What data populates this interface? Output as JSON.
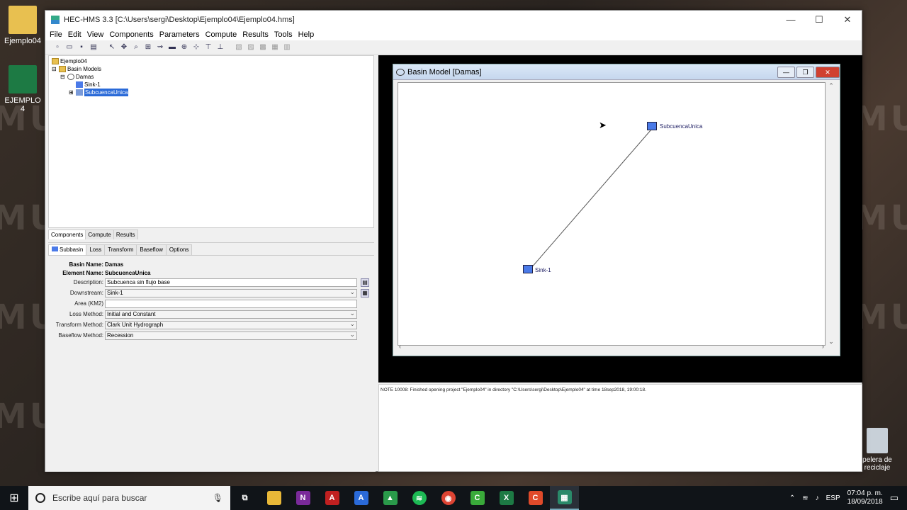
{
  "desktop": {
    "icons": [
      {
        "label": "Ejemplo04"
      },
      {
        "label": "EJEMPLO 4"
      },
      {
        "label": "pelera de reciclaje"
      }
    ],
    "wallpaper_text": "MUSE"
  },
  "window": {
    "title": "HEC-HMS 3.3 [C:\\Users\\sergi\\Desktop\\Ejemplo04\\Ejemplo04.hms]",
    "controls": {
      "minimize": "—",
      "maximize": "☐",
      "close": "✕"
    }
  },
  "menu": [
    "File",
    "Edit",
    "View",
    "Components",
    "Parameters",
    "Compute",
    "Results",
    "Tools",
    "Help"
  ],
  "tree": {
    "project": "Ejemplo04",
    "folder": "Basin Models",
    "basin": "Damas",
    "elements": [
      "Sink-1",
      "SubcuencaUnica"
    ]
  },
  "tree_tabs": [
    "Components",
    "Compute",
    "Results"
  ],
  "prop_tabs": [
    "Subbasin",
    "Loss",
    "Transform",
    "Baseflow",
    "Options"
  ],
  "props": {
    "basin_name_label": "Basin Name:",
    "basin_name": "Damas",
    "element_name_label": "Element Name:",
    "element_name": "SubcuencaUnica",
    "fields": [
      {
        "label": "Description:",
        "value": "Subcuenca sin flujo base",
        "type": "text"
      },
      {
        "label": "Downstream:",
        "value": "Sink-1",
        "type": "select"
      },
      {
        "label": "Area (KM2)",
        "value": "",
        "type": "text"
      },
      {
        "label": "Loss Method:",
        "value": "Initial and Constant",
        "type": "select"
      },
      {
        "label": "Transform Method:",
        "value": "Clark Unit Hydrograph",
        "type": "select"
      },
      {
        "label": "Baseflow Method:",
        "value": "Recession",
        "type": "select"
      }
    ]
  },
  "basin_window": {
    "title": "Basin Model [Damas]",
    "nodes": {
      "subbasin": "SubcuencaUnica",
      "sink": "Sink-1"
    }
  },
  "log": {
    "message": "NOTE 10008:  Finished opening project \"Ejemplo04\" in directory \"C:\\Users\\sergi\\Desktop\\Ejemplo04\" at time 18sep2018, 19:00:18."
  },
  "taskbar": {
    "search_placeholder": "Escribe aquí para buscar",
    "apps": [
      {
        "name": "task-view",
        "glyph": "⧉",
        "color": "#101418"
      },
      {
        "name": "file-explorer",
        "glyph": "▬",
        "color": "#e8b838"
      },
      {
        "name": "onenote",
        "glyph": "N",
        "color": "#7a2a9a"
      },
      {
        "name": "autocad",
        "glyph": "A",
        "color": "#c02020"
      },
      {
        "name": "app-a",
        "glyph": "A",
        "color": "#2a6ad8"
      },
      {
        "name": "image-app",
        "glyph": "▲",
        "color": "#2a9a4a"
      },
      {
        "name": "spotify",
        "glyph": "●",
        "color": "#1db954"
      },
      {
        "name": "chrome",
        "glyph": "◉",
        "color": "#dd4433"
      },
      {
        "name": "camtasia",
        "glyph": "C",
        "color": "#3aaa3a"
      },
      {
        "name": "excel",
        "glyph": "X",
        "color": "#1d7a44"
      },
      {
        "name": "camtasia-recorder",
        "glyph": "C",
        "color": "#e04a2a"
      },
      {
        "name": "hec-hms",
        "glyph": "▦",
        "color": "#2a8a6a"
      }
    ],
    "lang": "ESP",
    "time": "07:04 p. m.",
    "date": "18/09/2018"
  }
}
